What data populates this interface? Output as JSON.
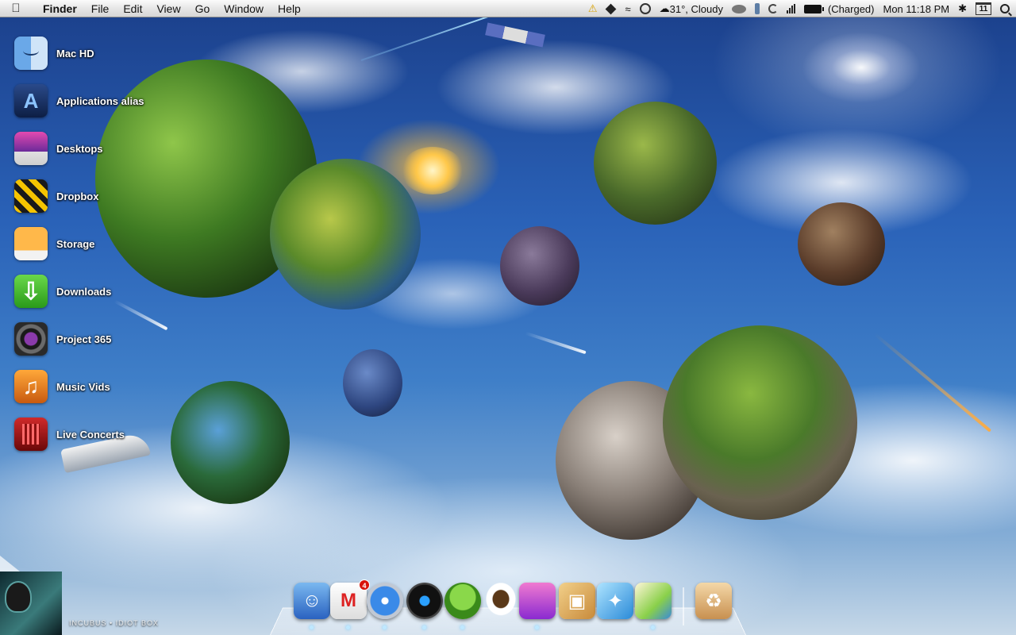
{
  "menubar": {
    "apple_icon": "apple-logo",
    "app_name": "Finder",
    "menus": [
      "File",
      "Edit",
      "View",
      "Go",
      "Window",
      "Help"
    ],
    "status": {
      "weather": "31°, Cloudy",
      "battery": "(Charged)",
      "clock": "Mon 11:18 PM",
      "calendar_day": "11"
    }
  },
  "desktop": {
    "icons": [
      {
        "label": "Mac HD",
        "icon": "finder-icon"
      },
      {
        "label": "Applications alias",
        "icon": "appstore-icon"
      },
      {
        "label": "Desktops",
        "icon": "desktops-icon"
      },
      {
        "label": "Dropbox",
        "icon": "dropbox-icon"
      },
      {
        "label": "Storage",
        "icon": "storage-icon"
      },
      {
        "label": "Downloads",
        "icon": "downloads-icon"
      },
      {
        "label": "Project 365",
        "icon": "camera-icon"
      },
      {
        "label": "Music Vids",
        "icon": "music-icon"
      },
      {
        "label": "Live Concerts",
        "icon": "concerts-icon"
      }
    ],
    "now_playing": "INCUBUS • IDIOT BOX"
  },
  "dock": {
    "items": [
      {
        "name": "finder",
        "icon": "finder-dock-icon"
      },
      {
        "name": "gmail",
        "icon": "gmail-icon",
        "badge": "4"
      },
      {
        "name": "safari",
        "icon": "safari-icon"
      },
      {
        "name": "itunes",
        "icon": "itunes-icon"
      },
      {
        "name": "adium",
        "icon": "adium-icon"
      },
      {
        "name": "caffeine",
        "icon": "coffee-cup-icon"
      },
      {
        "name": "candybar",
        "icon": "candybar-icon"
      },
      {
        "name": "iphoto",
        "icon": "iphoto-icon"
      },
      {
        "name": "xcode",
        "icon": "xcode-icon"
      },
      {
        "name": "preview",
        "icon": "preview-icon"
      },
      {
        "name": "trash",
        "icon": "trash-icon"
      }
    ],
    "running_indicator_color": "#bfe8ff"
  },
  "colors": {
    "menubar_bg": "#e6e6e6",
    "sky_top": "#1b3f8a",
    "sky_bottom": "#c6d8e8",
    "badge_red": "#d8120a"
  }
}
